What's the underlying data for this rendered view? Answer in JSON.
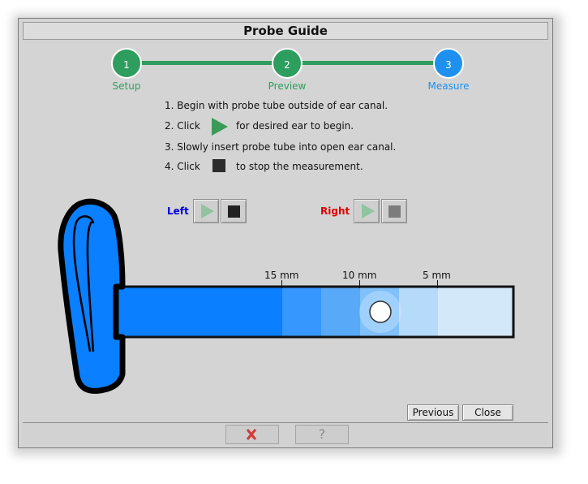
{
  "window": {
    "title": "Probe Guide"
  },
  "stepper": {
    "steps": [
      {
        "number": "1",
        "label": "Setup",
        "status": "complete"
      },
      {
        "number": "2",
        "label": "Preview",
        "status": "complete"
      },
      {
        "number": "3",
        "label": "Measure",
        "status": "current"
      }
    ],
    "complete_color": "#2e9e5e",
    "current_color": "#1e90f0"
  },
  "instructions": {
    "line1": "1. Begin with probe tube outside of ear canal.",
    "line2_before": "2. Click",
    "line2_after": "for desired ear to begin.",
    "line3": "3. Slowly insert probe tube into open ear canal.",
    "line4_before": "4. Click",
    "line4_after": "to stop the measurement."
  },
  "controls": {
    "left": {
      "label": "Left",
      "color": "#0000dd"
    },
    "right": {
      "label": "Right",
      "color": "#e00000"
    }
  },
  "ruler": {
    "labels": [
      "15 mm",
      "10 mm",
      "5 mm"
    ]
  },
  "footer": {
    "previous_label": "Previous",
    "close_label": "Close",
    "help_label": "?"
  },
  "colors": {
    "probe_blue": "#0a7fff",
    "success_green": "#3a9a58"
  }
}
